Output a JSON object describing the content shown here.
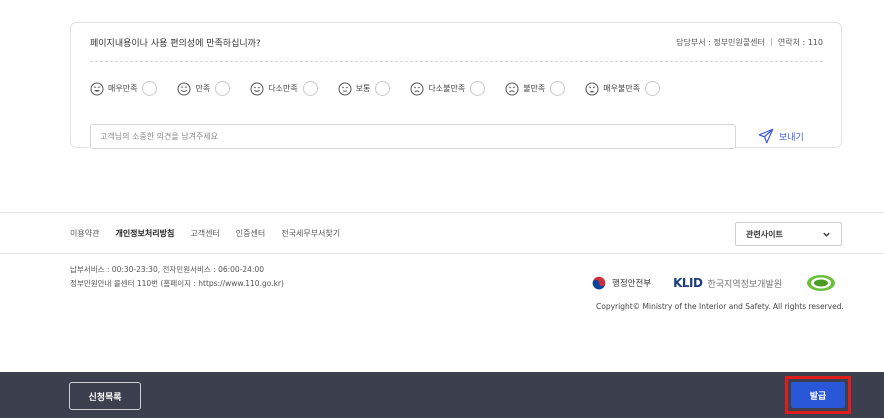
{
  "survey": {
    "question": "페이지내용이나 사용 편의성에 만족하십니까?",
    "department": "담당부서 : 정부민원콜센터",
    "contact": "연락처 : 110",
    "ratings": [
      {
        "label": "매우만족",
        "face": "very-satisfied"
      },
      {
        "label": "만족",
        "face": "satisfied"
      },
      {
        "label": "다소만족",
        "face": "somewhat-satisfied"
      },
      {
        "label": "보통",
        "face": "neutral"
      },
      {
        "label": "다소불만족",
        "face": "somewhat-dissatisfied"
      },
      {
        "label": "불만족",
        "face": "dissatisfied"
      },
      {
        "label": "매우불만족",
        "face": "very-dissatisfied"
      }
    ],
    "opinion_placeholder": "고객님의 소중한 의견을 남겨주세요",
    "opinion_value": "",
    "send_label": "보내기",
    "send_icon": "paper-plane-icon"
  },
  "footer": {
    "links": [
      {
        "label": "이용약관",
        "bold": false
      },
      {
        "label": "개인정보처리방침",
        "bold": true
      },
      {
        "label": "고객센터",
        "bold": false
      },
      {
        "label": "인증센터",
        "bold": false
      },
      {
        "label": "전국세무부서찾기",
        "bold": false
      }
    ],
    "related_sites_label": "관련사이트",
    "info_line1": "납부서비스 : 00:30-23:30, 전자민원서비스 : 06:00-24:00",
    "info_line2": "정부민원안내 콜센터 110번 (홈페이지 : https://www.110.go.kr)",
    "logo_mois": "행정안전부",
    "logo_klid_mark": "KLID",
    "logo_klid_text": "한국지역정보개발원",
    "copyright": "Copyright© Ministry of the Interior and Safety. All rights reserved."
  },
  "actions": {
    "list_label": "신청목록",
    "issue_label": "발급"
  },
  "colors": {
    "action_bar": "#3b3f4e",
    "issue_button": "#2a57d8",
    "highlight_border": "#e01d1d",
    "send_accent": "#3b5bdb"
  }
}
